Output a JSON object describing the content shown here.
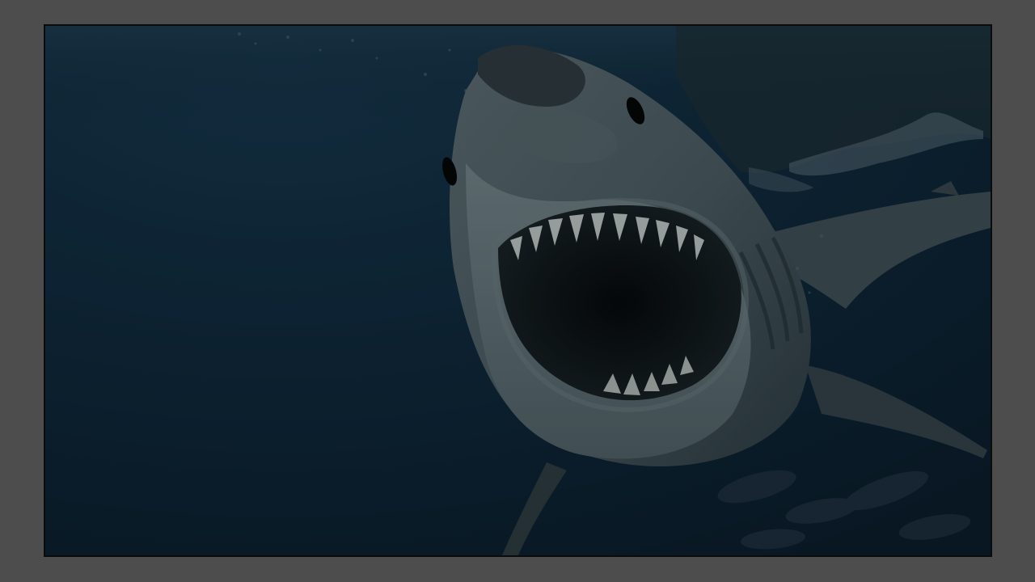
{
  "page": {
    "background_color": "#4d4d4d",
    "frame_border_color": "#0b0b0b"
  },
  "image": {
    "subject": "shark-underwater",
    "water_color": "#102a3d",
    "deep_water_color": "#0b1d2b",
    "shark_body_color": "#4a5a61",
    "shark_belly_color": "#6d7d82",
    "mouth_color": "#0a1114",
    "teeth_color": "#b8bfbd"
  }
}
